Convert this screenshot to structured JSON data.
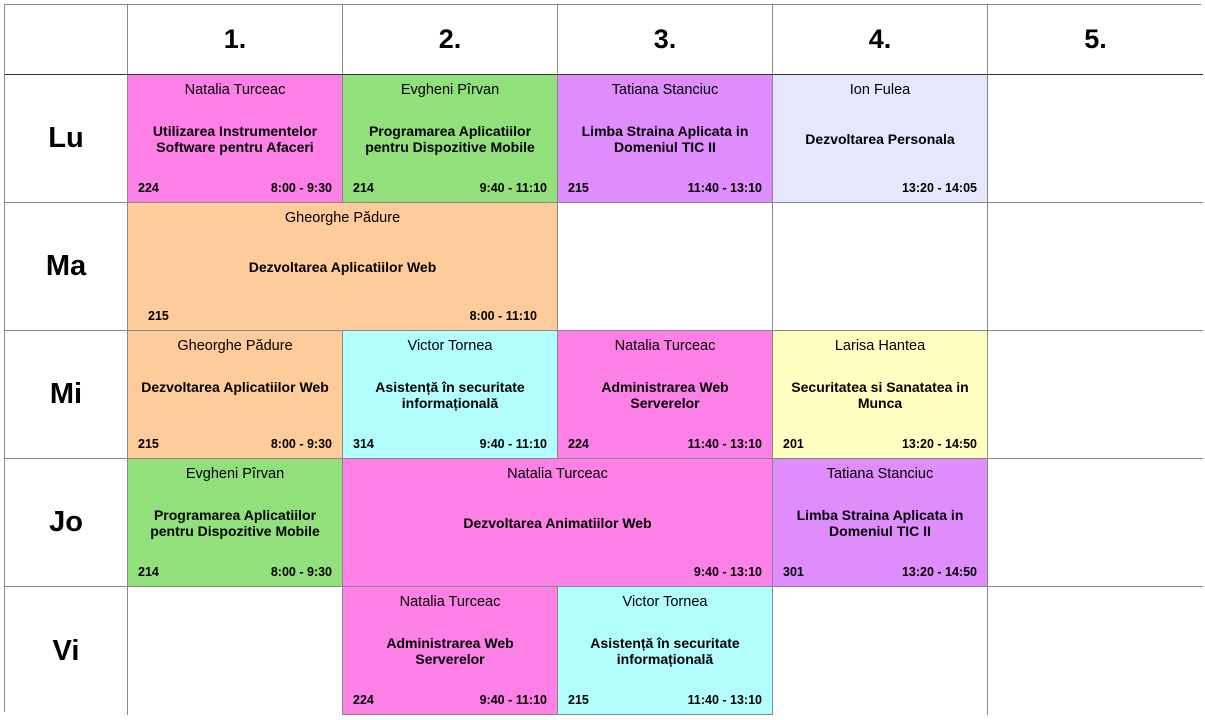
{
  "columns": [
    "1.",
    "2.",
    "3.",
    "4.",
    "5."
  ],
  "days": [
    "Lu",
    "Ma",
    "Mi",
    "Jo",
    "Vi"
  ],
  "colors": {
    "pink": "#fd80e6",
    "green": "#92e07b",
    "purple": "#df8dfd",
    "lavender": "#e6e6fe",
    "orange": "#fecb9a",
    "cyan": "#b2fefe",
    "yellow": "#feffc0",
    "grid_line": "#888888"
  },
  "lessons": {
    "lu_1": {
      "teacher": "Natalia Turceac",
      "subject": "Utilizarea Instrumentelor Software pentru Afaceri",
      "room": "224",
      "time": "8:00 - 9:30"
    },
    "lu_2": {
      "teacher": "Evgheni Pîrvan",
      "subject": "Programarea Aplicatiilor pentru Dispozitive Mobile",
      "room": "214",
      "time": "9:40 - 11:10"
    },
    "lu_3": {
      "teacher": "Tatiana Stanciuc",
      "subject": "Limba Straina Aplicata in Domeniul TIC II",
      "room": "215",
      "time": "11:40 - 13:10"
    },
    "lu_4": {
      "teacher": "Ion Fulea",
      "subject": "Dezvoltarea Personala",
      "room": "",
      "time": "13:20 - 14:05"
    },
    "ma_1": {
      "teacher": "Gheorghe Pădure",
      "subject": "Dezvoltarea Aplicatiilor Web",
      "room": "215",
      "time": "8:00 - 11:10"
    },
    "mi_1": {
      "teacher": "Gheorghe Pădure",
      "subject": "Dezvoltarea Aplicatiilor Web",
      "room": "215",
      "time": "8:00 - 9:30"
    },
    "mi_2": {
      "teacher": "Victor Tornea",
      "subject": "Asistență în securitate informațională",
      "room": "314",
      "time": "9:40 - 11:10"
    },
    "mi_3": {
      "teacher": "Natalia Turceac",
      "subject": "Administrarea Web Serverelor",
      "room": "224",
      "time": "11:40 - 13:10"
    },
    "mi_4": {
      "teacher": "Larisa Hantea",
      "subject": "Securitatea si Sanatatea in Munca",
      "room": "201",
      "time": "13:20 - 14:50"
    },
    "jo_1": {
      "teacher": "Evgheni Pîrvan",
      "subject": "Programarea Aplicatiilor pentru Dispozitive Mobile",
      "room": "214",
      "time": "8:00 - 9:30"
    },
    "jo_2": {
      "teacher": "Natalia Turceac",
      "subject": "Dezvoltarea Animatiilor Web",
      "room": "",
      "time": "9:40 - 13:10"
    },
    "jo_4": {
      "teacher": "Tatiana Stanciuc",
      "subject": "Limba Straina Aplicata in Domeniul TIC II",
      "room": "301",
      "time": "13:20 - 14:50"
    },
    "vi_2": {
      "teacher": "Natalia Turceac",
      "subject": "Administrarea Web Serverelor",
      "room": "224",
      "time": "9:40 - 11:10"
    },
    "vi_3": {
      "teacher": "Victor Tornea",
      "subject": "Asistență în securitate informațională",
      "room": "215",
      "time": "11:40 - 13:10"
    }
  }
}
